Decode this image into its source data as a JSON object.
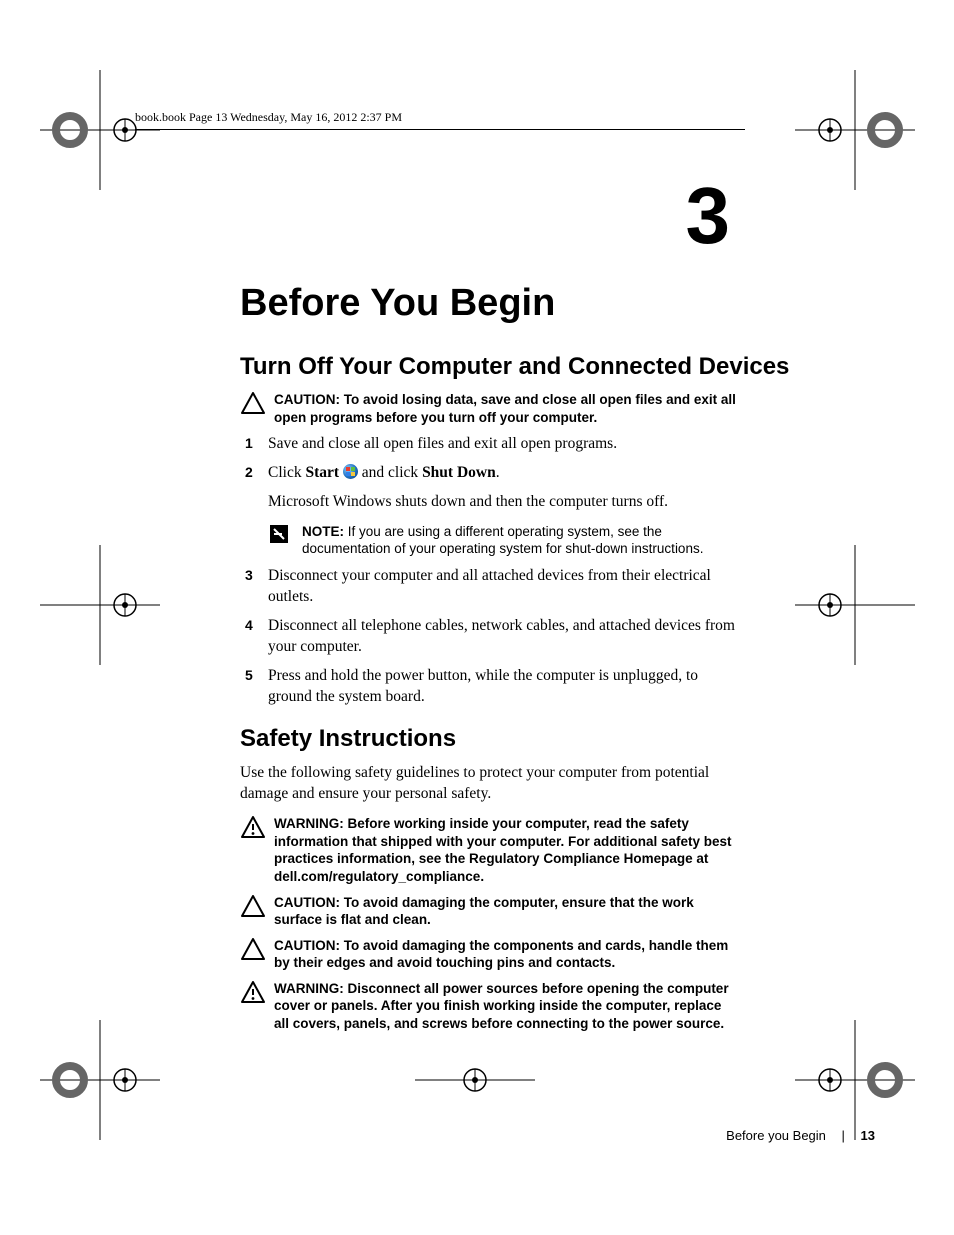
{
  "header": "book.book  Page 13  Wednesday, May 16, 2012  2:37 PM",
  "chapter_number": "3",
  "chapter_title": "Before You Begin",
  "section1": {
    "title": "Turn Off Your Computer and Connected Devices",
    "caution": {
      "label": "CAUTION: ",
      "text": "To avoid losing data, save and close all open files and exit all open programs before you turn off your computer."
    },
    "steps": {
      "s1": "Save and close all open files and exit all open programs.",
      "s2_a": "Click ",
      "s2_b": "Start",
      "s2_c": " and click ",
      "s2_d": "Shut Down",
      "s2_e": ".",
      "s2_cont": "Microsoft Windows shuts down and then the computer turns off.",
      "note": {
        "label": "NOTE: ",
        "text": "If you are using a different operating system, see the documentation of your operating system for shut-down instructions."
      },
      "s3": "Disconnect your computer and all attached devices from their electrical outlets.",
      "s4": "Disconnect all telephone cables, network cables, and attached devices from your computer.",
      "s5": "Press and hold the power button, while the computer is unplugged, to ground the system board."
    }
  },
  "section2": {
    "title": "Safety Instructions",
    "intro": "Use the following safety guidelines to protect your computer from potential damage and ensure your personal safety.",
    "warn1": {
      "label": "WARNING: ",
      "text": "Before working inside your computer, read the safety information that shipped with your computer. For additional safety best practices information, see the Regulatory Compliance Homepage at dell.com/regulatory_compliance."
    },
    "caution1": {
      "label": "CAUTION: ",
      "text": "To avoid damaging the computer, ensure that the work surface is flat and clean."
    },
    "caution2": {
      "label": "CAUTION: ",
      "text": "To avoid damaging the components and cards, handle them by their edges and avoid touching pins and contacts."
    },
    "warn2": {
      "label": "WARNING: ",
      "text": "Disconnect all power sources before opening the computer cover or panels. After you finish working inside the computer, replace all covers, panels, and screws before connecting to the power source."
    }
  },
  "footer": {
    "section": "Before you Begin",
    "page": "13"
  }
}
